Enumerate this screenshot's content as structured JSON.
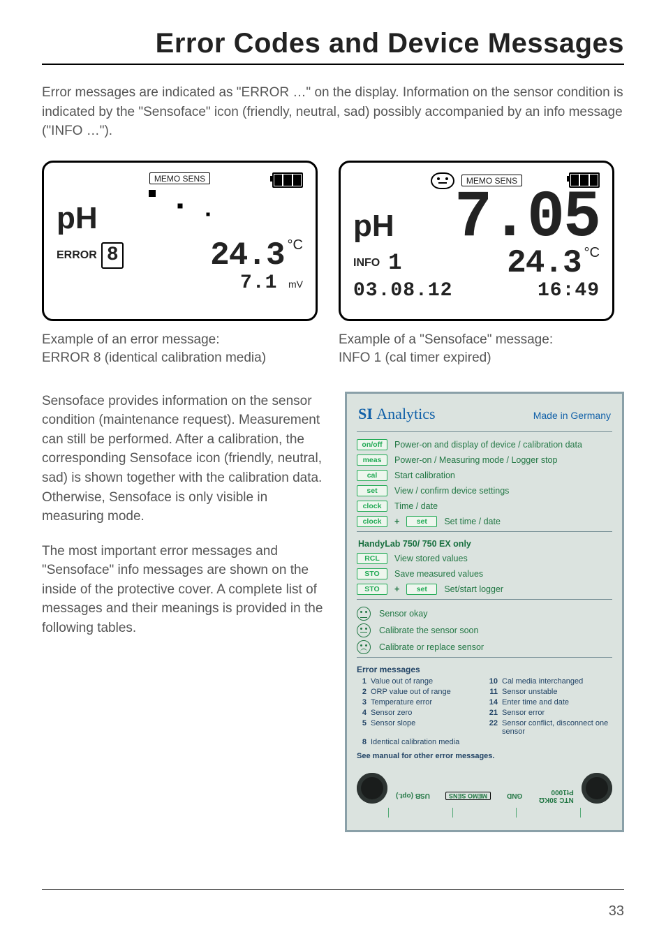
{
  "title": "Error Codes and Device Messages",
  "intro": "Error messages are indicated as \"ERROR …\" on the display. Information on the sensor condition is indicated by the \"Sensoface\" icon (friendly, neutral, sad) possibly accompanied by an info message (\"INFO …\").",
  "lcd_common": {
    "memosens": "MEMO   SENS",
    "ph": "pH",
    "deg_c": "°C",
    "mv": "mV"
  },
  "lcd_left": {
    "error_label": "ERROR",
    "error_code": "8",
    "temp": "24.3",
    "mv_value": "7.1",
    "caption_l1": "Example of an error message:",
    "caption_l2": "ERROR 8 (identical calibration media)"
  },
  "lcd_right": {
    "main": "7.05",
    "temp": "24.3",
    "info_label": "INFO",
    "info_code": "1",
    "date": "03.08.12",
    "time": "16:49",
    "caption_l1": "Example of a \"Sensoface\" message:",
    "caption_l2": "INFO 1 (cal timer expired)"
  },
  "body": {
    "p1": "Sensoface provides information on the sensor condition (maintenance request). Measurement can still be performed. After a calibration, the corresponding Sensoface icon (friendly, neutral, sad) is shown together with the calibration data. Otherwise, Sensoface is only visible in measuring mode.",
    "p2": "The most important error messages and \"Sensoface\" info messages are shown on the inside of the protective cover. A complete list of messages and their meanings is provided in the following tables."
  },
  "panel": {
    "brand_prefix": "SI ",
    "brand_main": "Analytics",
    "made": "Made in Germany",
    "rows": [
      {
        "chip": "on/off",
        "text": "Power-on and display of device / calibration data"
      },
      {
        "chip": "meas",
        "text": "Power-on / Measuring mode / Logger stop"
      },
      {
        "chip": "cal",
        "text": "Start calibration"
      },
      {
        "chip": "set",
        "text": "View / confirm device settings"
      },
      {
        "chip": "clock",
        "text": "Time / date"
      },
      {
        "chip": "clock",
        "plus": "+",
        "chip2": "set",
        "text": "Set time / date"
      }
    ],
    "section2_head": "HandyLab 750/ 750 EX only",
    "rows2": [
      {
        "chip": "RCL",
        "text": "View stored values"
      },
      {
        "chip": "STO",
        "text": "Save measured values"
      },
      {
        "chip": "STO",
        "plus": "+",
        "chip2": "set",
        "text": "Set/start logger"
      }
    ],
    "faces": [
      {
        "cls": "happy",
        "text": "Sensor okay"
      },
      {
        "cls": "neut",
        "text": "Calibrate the sensor soon"
      },
      {
        "cls": "sad",
        "text": "Calibrate or replace sensor"
      }
    ],
    "err_head": "Error messages",
    "errors_left": [
      {
        "n": "1",
        "t": "Value out of range"
      },
      {
        "n": "2",
        "t": "ORP value out of range"
      },
      {
        "n": "3",
        "t": "Temperature error"
      },
      {
        "n": "4",
        "t": "Sensor zero"
      },
      {
        "n": "5",
        "t": "Sensor slope"
      },
      {
        "n": "8",
        "t": "Identical calibration media"
      }
    ],
    "errors_right": [
      {
        "n": "10",
        "t": "Cal media interchanged"
      },
      {
        "n": "11",
        "t": "Sensor unstable"
      },
      {
        "n": "14",
        "t": "Enter time and date"
      },
      {
        "n": "21",
        "t": "Sensor error"
      },
      {
        "n": "22",
        "t": "Sensor conflict, disconnect one sensor"
      }
    ],
    "see_manual": "See manual for other error messages.",
    "foot": {
      "usb": "USB (opt.)",
      "memosens": "MEMO   SENS",
      "gnd": "GND",
      "ntc_a": "NTC 30KΩ",
      "ntc_b": "Pt1000"
    }
  },
  "page_number": "33"
}
